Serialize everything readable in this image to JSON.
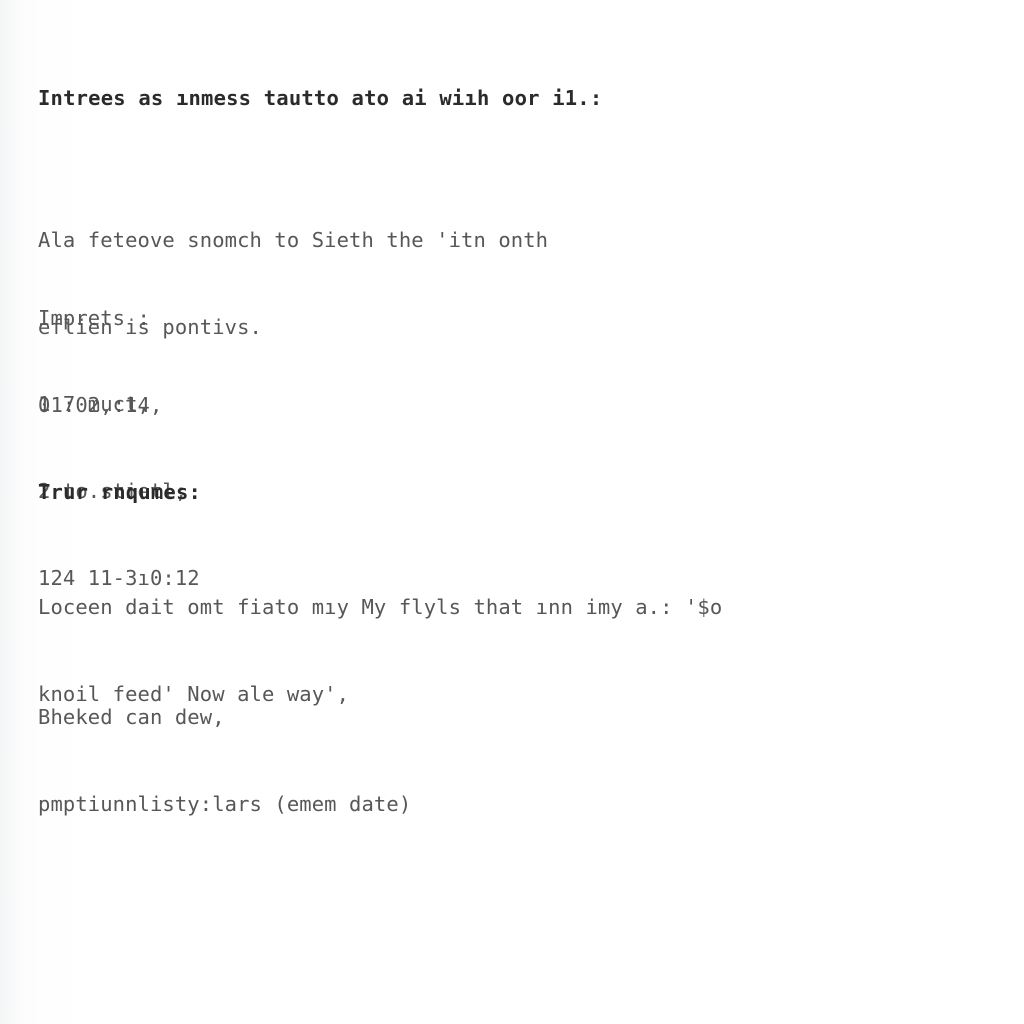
{
  "document": {
    "background_color": "#ffffff",
    "heading_color": "#2b2b2b",
    "body_color": "#575757",
    "heading_main": "Intrees as ınmess tautto ato ai wiıh oor i1.:",
    "paragraph_intro": {
      "line1": "Ala feteove snomch to Sieth the 'itn onth",
      "line2": "eflien is pontivs."
    },
    "imprets": {
      "label": "Imprets :",
      "value": "01:02,:14,"
    },
    "list": {
      "item1": "1 7 muct,",
      "item2": "2 to.stietl;",
      "item3": "124 11-3ı0:12"
    },
    "heading_second": "Trur rnqumes:",
    "paragraph_body": {
      "line1": "Loceen dait omt fiato mıy My flyls that ınn imy a.: '$o",
      "line2": "knoil feed' Now ale way',"
    },
    "closing": {
      "line1": "Bheked can dew,",
      "line2": "pmptiunnlisty:lars (emem date)"
    }
  }
}
